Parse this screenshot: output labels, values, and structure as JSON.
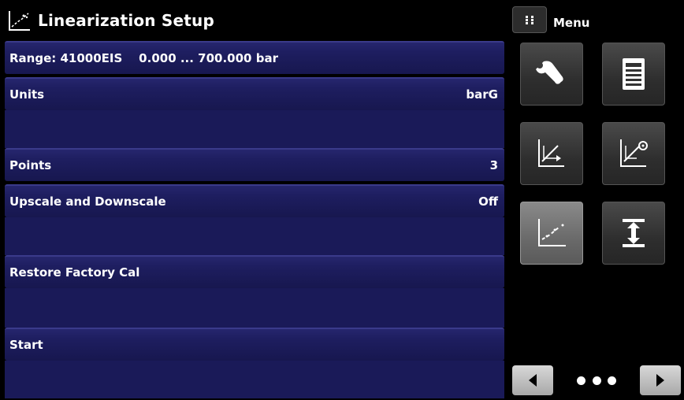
{
  "header": {
    "title": "Linearization Setup",
    "icon": "linearization-icon"
  },
  "rows": [
    {
      "label": "Range: 41000EIS    0.000 ... 700.000 bar",
      "value": ""
    },
    {
      "label": "Units",
      "value": "barG"
    },
    {
      "label": "Points",
      "value": "3"
    },
    {
      "label": "Upscale and Downscale",
      "value": "Off"
    },
    {
      "label": "Restore Factory Cal",
      "value": ""
    },
    {
      "label": "Start",
      "value": ""
    }
  ],
  "menu": {
    "label": "Menu",
    "tiles": [
      {
        "icon": "wrench-icon",
        "active": false
      },
      {
        "icon": "document-icon",
        "active": false
      },
      {
        "icon": "calibration-icon",
        "active": false
      },
      {
        "icon": "calibration-settings-icon",
        "active": false
      },
      {
        "icon": "linearization-icon",
        "active": true
      },
      {
        "icon": "range-icon",
        "active": false
      }
    ]
  },
  "pager": {
    "pages": 3
  },
  "colors": {
    "row": "#1e1e60",
    "row_highlight": "#3a3a8a",
    "tile": "#2e2e2e",
    "tile_active": "#6a6a6a"
  }
}
